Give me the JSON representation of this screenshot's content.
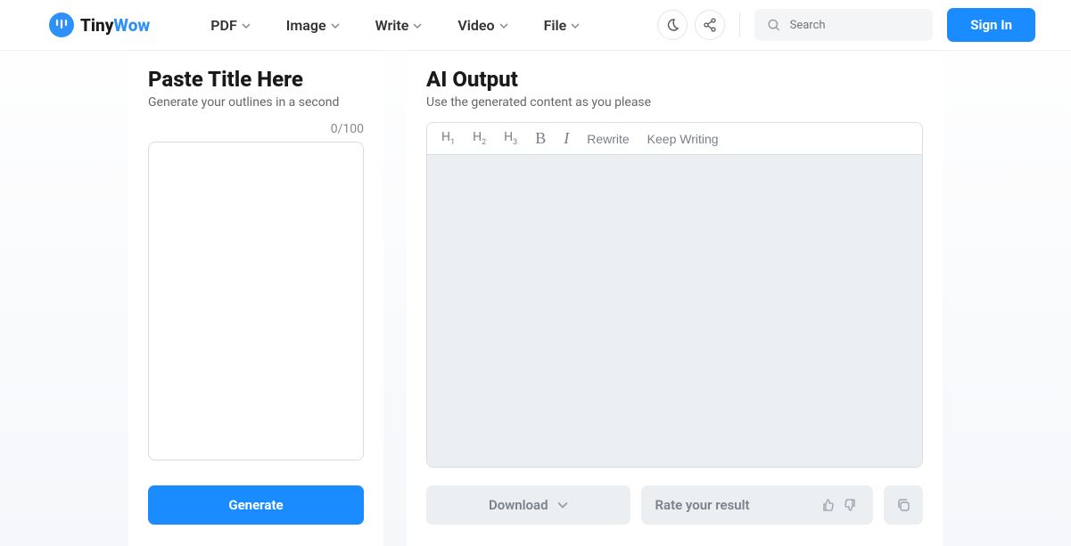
{
  "brand": {
    "tiny": "Tiny",
    "wow": "Wow"
  },
  "nav": {
    "pdf": "PDF",
    "image": "Image",
    "write": "Write",
    "video": "Video",
    "file": "File"
  },
  "search": {
    "placeholder": "Search"
  },
  "signin": "Sign In",
  "left": {
    "title": "Paste Title Here",
    "sub": "Generate your outlines in a second",
    "counter": "0/100",
    "cta": "Generate"
  },
  "right": {
    "title": "AI Output",
    "sub": "Use the generated content as you please",
    "toolbar": {
      "h1": "H",
      "h1s": "1",
      "h2": "H",
      "h2s": "2",
      "h3": "H",
      "h3s": "3",
      "bold": "B",
      "italic": "I",
      "rewrite": "Rewrite",
      "keep": "Keep Writing"
    },
    "download": "Download",
    "rate": "Rate your result"
  }
}
